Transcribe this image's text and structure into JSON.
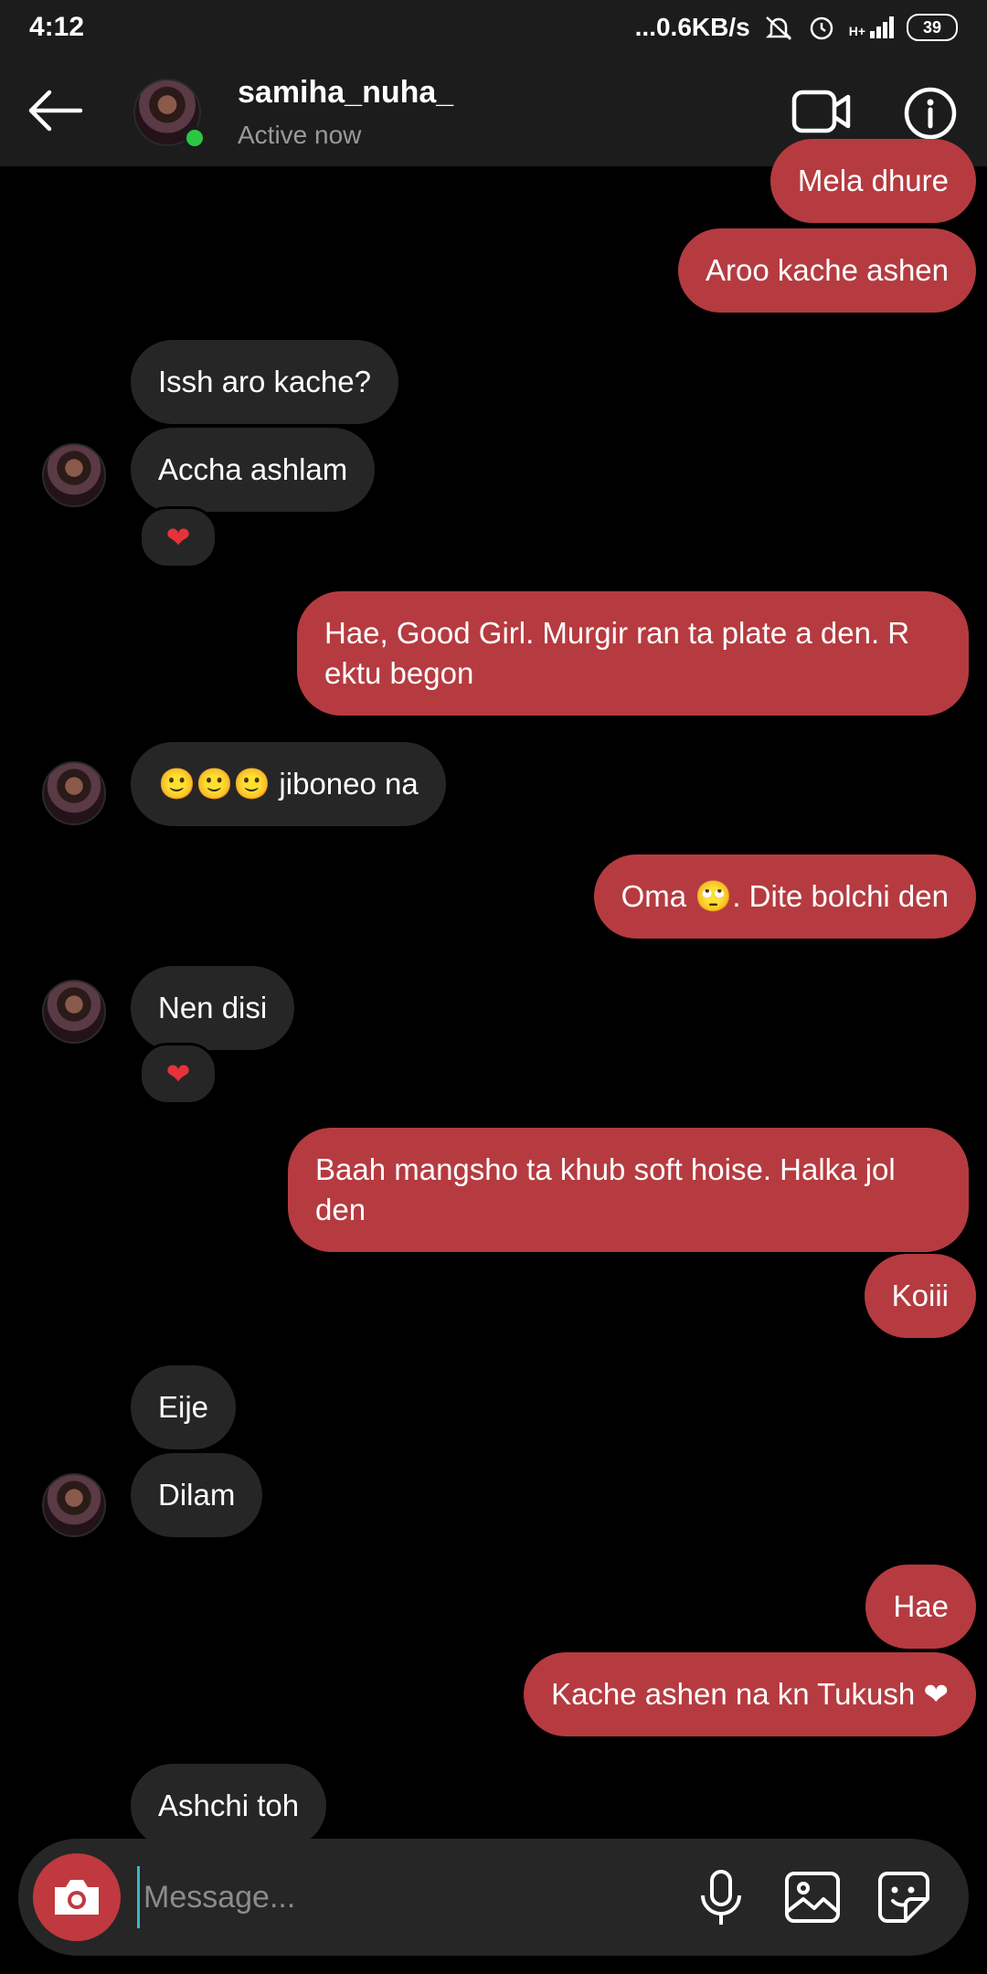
{
  "status_bar": {
    "time": "4:12",
    "network_speed": "...0.6KB/s",
    "signal": "H+",
    "battery": "39"
  },
  "header": {
    "username": "samiha_nuha_",
    "status": "Active now"
  },
  "messages": [
    {
      "from": "me",
      "text": "Mela dhure"
    },
    {
      "from": "me",
      "text": "Aroo kache ashen"
    },
    {
      "from": "them",
      "text": "Issh aro kache?"
    },
    {
      "from": "them",
      "text": "Accha ashlam",
      "reaction": "❤"
    },
    {
      "from": "me",
      "text": "Hae, Good Girl. Murgir ran ta plate a den. R ektu begon"
    },
    {
      "from": "them",
      "text": "🙂🙂🙂 jiboneo na"
    },
    {
      "from": "me",
      "text": "Oma 🙄. Dite bolchi den"
    },
    {
      "from": "them",
      "text": "Nen disi",
      "reaction": "❤"
    },
    {
      "from": "me",
      "text": "Baah mangsho ta khub soft hoise. Halka jol den"
    },
    {
      "from": "me",
      "text": "Koiii"
    },
    {
      "from": "them",
      "text": "Eije"
    },
    {
      "from": "them",
      "text": "Dilam"
    },
    {
      "from": "me",
      "text": "Hae"
    },
    {
      "from": "me",
      "text": "Kache ashen na kn Tukush ❤"
    },
    {
      "from": "them",
      "text": "Ashchi toh"
    }
  ],
  "composer": {
    "placeholder": "Message..."
  },
  "icons": [
    "back-arrow-icon",
    "video-call-icon",
    "info-icon",
    "camera-icon",
    "microphone-icon",
    "gallery-icon",
    "sticker-icon"
  ],
  "colors": {
    "sent_bubble": "#b53b40",
    "received_bubble": "#262626",
    "online": "#2bc741"
  }
}
